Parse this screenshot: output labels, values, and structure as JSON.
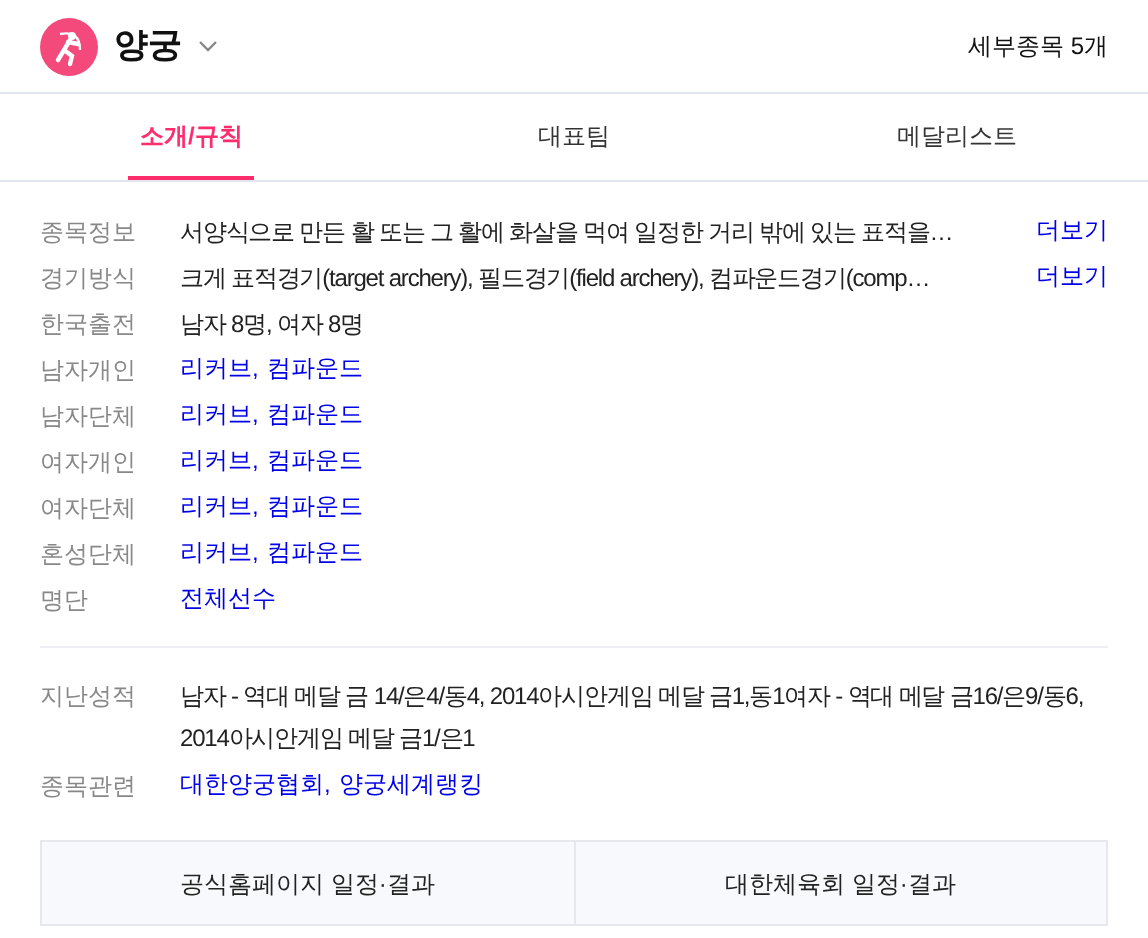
{
  "header": {
    "title": "양궁",
    "subcount": "세부종목 5개"
  },
  "tabs": [
    {
      "label": "소개/규칙",
      "selected": true
    },
    {
      "label": "대표팀",
      "selected": false
    },
    {
      "label": "메달리스트",
      "selected": false
    }
  ],
  "info": [
    {
      "label": "종목정보",
      "kind": "text",
      "value": "서양식으로 만든 활 또는 그 활에 화살을 먹여 일정한 거리 밖에 있는 표적을…",
      "more": "더보기"
    },
    {
      "label": "경기방식",
      "kind": "text",
      "value": "크게 표적경기(target archery), 필드경기(field archery), 컴파운드경기(comp…",
      "more": "더보기"
    },
    {
      "label": "한국출전",
      "kind": "text",
      "value": "남자 8명, 여자 8명"
    },
    {
      "label": "남자개인",
      "kind": "links",
      "links": [
        "리커브,",
        "컴파운드"
      ]
    },
    {
      "label": "남자단체",
      "kind": "links",
      "links": [
        "리커브,",
        "컴파운드"
      ]
    },
    {
      "label": "여자개인",
      "kind": "links",
      "links": [
        "리커브,",
        "컴파운드"
      ]
    },
    {
      "label": "여자단체",
      "kind": "links",
      "links": [
        "리커브,",
        "컴파운드"
      ]
    },
    {
      "label": "혼성단체",
      "kind": "links",
      "links": [
        "리커브,",
        "컴파운드"
      ]
    },
    {
      "label": "명단",
      "kind": "links",
      "links": [
        "전체선수"
      ]
    }
  ],
  "history": [
    {
      "label": "지난성적",
      "kind": "text",
      "value": "남자 - 역대 메달 금 14/은4/동4, 2014아시안게임 메달 금1,동1여자 - 역대 메달 금16/은9/동6, 2014아시안게임 메달 금1/은1"
    },
    {
      "label": "종목관련",
      "kind": "links",
      "links": [
        "대한양궁협회,",
        "양궁세계랭킹"
      ]
    }
  ],
  "buttons": [
    "공식홈페이지 일정·결과",
    "대한체육회 일정·결과"
  ]
}
